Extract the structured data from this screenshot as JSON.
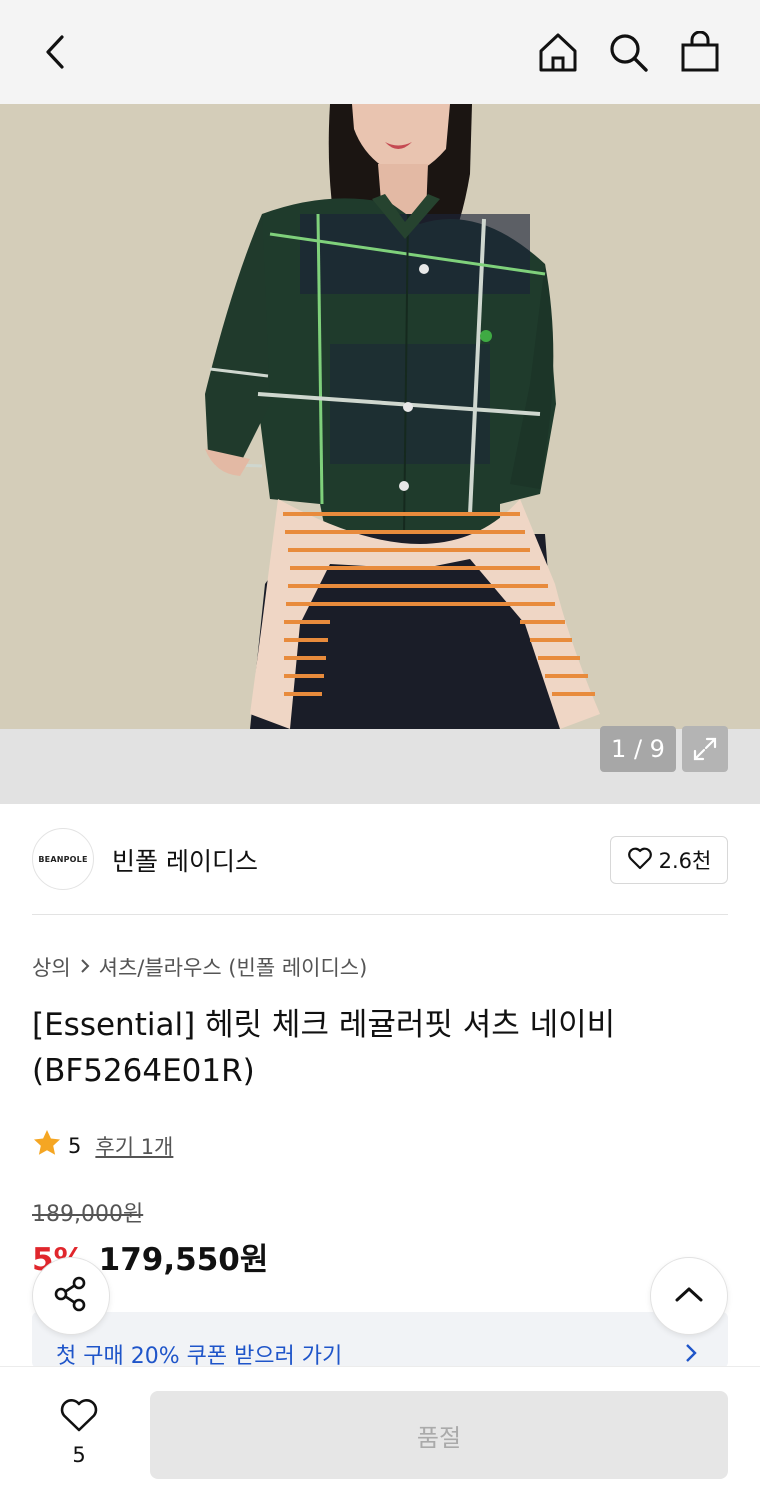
{
  "header": {
    "back_icon": "chevron-left-icon",
    "home_icon": "home-icon",
    "search_icon": "search-icon",
    "cart_icon": "shopping-bag-icon"
  },
  "gallery": {
    "image_description": "product-photo",
    "counter": "1 / 9",
    "expand_icon": "expand-icon"
  },
  "brand": {
    "logo_text": "BEANPOLE",
    "name": "빈폴 레이디스",
    "like_count": "2.6천"
  },
  "breadcrumb": {
    "category": "상의",
    "subcategory": "셔츠/블라우스 (빈폴 레이디스)"
  },
  "product": {
    "title": "[Essential] 헤릿 체크 레귤러핏 셔츠 네이비 (BF5264E01R)"
  },
  "rating": {
    "score": "5",
    "reviews_label": "후기 1개"
  },
  "price": {
    "original": "189,000원",
    "discount": "5%",
    "sale": "179,550원"
  },
  "coupon": {
    "text": "첫 구매 20% 쿠폰 받으러 가기"
  },
  "bottom": {
    "wish_count": "5",
    "buy_label": "품절"
  },
  "colors": {
    "accent_blue": "#1f55c9",
    "discount_red": "#e0262c",
    "star": "#f5a623"
  }
}
